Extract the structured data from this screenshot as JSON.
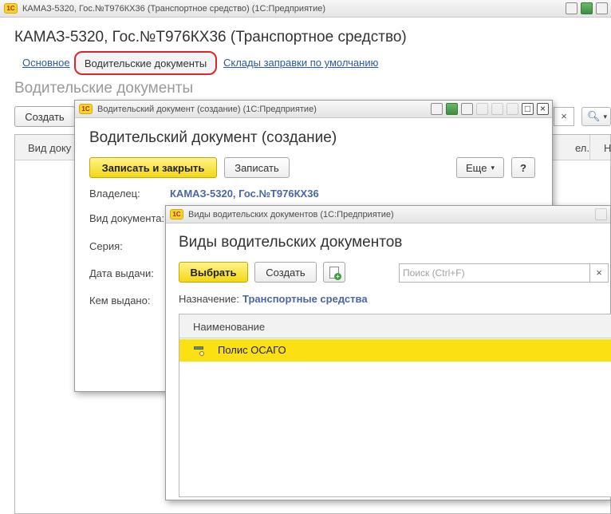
{
  "main_window": {
    "titlebar": "КАМАЗ-5320, Гос.№Т976КХ36 (Транспортное средство)  (1С:Предприятие)",
    "title": "КАМАЗ-5320, Гос.№Т976КХ36 (Транспортное средство)",
    "tabs": [
      {
        "label": "Основное"
      },
      {
        "label": "Водительские документы"
      },
      {
        "label": "Склады заправки по умолчанию"
      }
    ],
    "section_title": "Водительские документы",
    "create_button": "Создать",
    "columns": [
      "Вид доку",
      "ел.",
      "Н"
    ],
    "search_clear": "×",
    "search_dropdown": "▾"
  },
  "doc_window": {
    "titlebar": "Водительский документ (создание)  (1С:Предприятие)",
    "title": "Водительский документ (создание)",
    "buttons": {
      "save_close": "Записать и закрыть",
      "save": "Записать",
      "more": "Еще",
      "help": "?"
    },
    "fields": {
      "owner_label": "Владелец:",
      "owner_value": "КАМАЗ-5320, Гос.№Т976КХ36",
      "doc_type_label": "Вид документа:",
      "series_label": "Серия:",
      "issue_date_label": "Дата выдачи:",
      "issued_by_label": "Кем выдано:"
    }
  },
  "types_window": {
    "titlebar": "Виды водительских документов  (1С:Предприятие)",
    "title": "Виды водительских документов",
    "buttons": {
      "select": "Выбрать",
      "create": "Создать"
    },
    "search": {
      "placeholder": "Поиск (Ctrl+F)",
      "clear": "×"
    },
    "purpose_label": "Назначение:",
    "purpose_value": "Транспортные средства",
    "column_header": "Наименование",
    "rows": [
      {
        "name": "Полис ОСАГО"
      }
    ]
  },
  "logo_text": "1С",
  "colors": {
    "accent_yellow": "#f3d716",
    "selected_row": "#fbe014",
    "link": "#2c5aa0",
    "highlight_ring": "#d9272e"
  }
}
